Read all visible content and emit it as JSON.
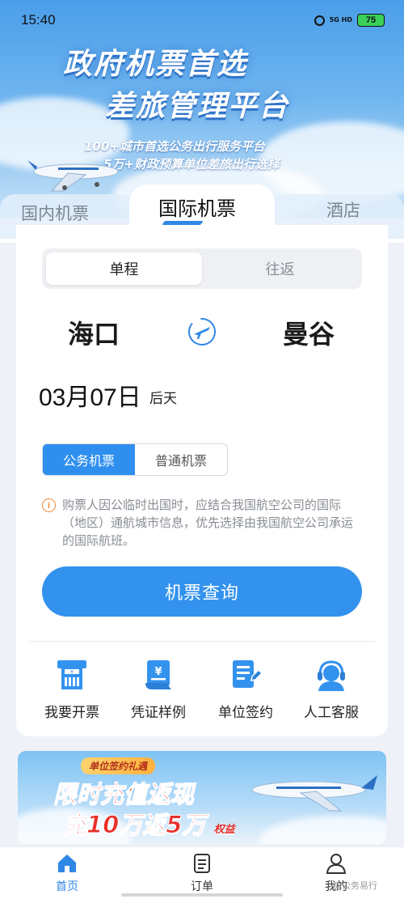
{
  "status_bar": {
    "time": "15:40",
    "network": "5G HD",
    "battery": "75"
  },
  "hero": {
    "title_line1": "政府机票首选",
    "title_line2": "差旅管理平台",
    "sub_line1": "100+城市首选公务出行服务平台",
    "sub_line2": "5万+财政预算单位差旅出行选择"
  },
  "tabs": {
    "domestic": "国内机票",
    "international": "国际机票",
    "hotel": "酒店"
  },
  "trip_type": {
    "oneway": "单程",
    "round": "往返"
  },
  "route": {
    "from": "海口",
    "to": "曼谷"
  },
  "date": {
    "value": "03月07日",
    "relative": "后天"
  },
  "ticket_type": {
    "official": "公务机票",
    "regular": "普通机票"
  },
  "notice": "购票人因公临时出国时，应结合我国航空公司的国际（地区）通航城市信息，优先选择由我国航空公司承运的国际航班。",
  "search_button": "机票查询",
  "quick_actions": [
    {
      "label": "我要开票",
      "icon": "invoice-icon"
    },
    {
      "label": "凭证样例",
      "icon": "voucher-icon"
    },
    {
      "label": "单位签约",
      "icon": "contract-icon"
    },
    {
      "label": "人工客服",
      "icon": "customer-service-icon"
    }
  ],
  "promo": {
    "pill": "单位签约礼遇",
    "line1": "限时充值返现",
    "line2": "充10万返5万",
    "line2_tag": "权益"
  },
  "bottom_nav": {
    "home": "首页",
    "orders": "订单",
    "mine": "我的"
  },
  "watermark": "@公务易行",
  "colors": {
    "primary": "#3392ee",
    "notice_icon": "#f08a3c",
    "promo_red": "#e8302a"
  }
}
